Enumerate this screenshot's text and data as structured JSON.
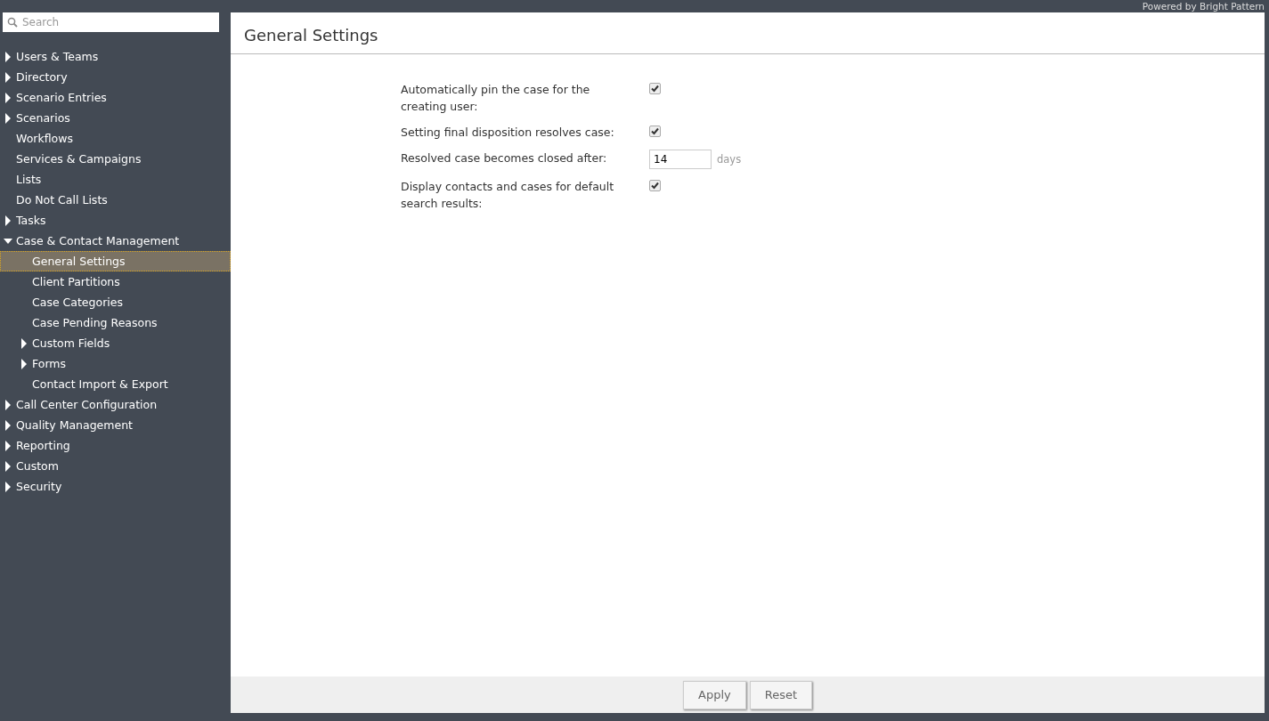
{
  "brand": "Powered by Bright Pattern",
  "search": {
    "placeholder": "Search"
  },
  "sidebar": {
    "items": [
      {
        "label": "Users & Teams",
        "expanded": false,
        "selected": false
      },
      {
        "label": "Directory",
        "expanded": false,
        "selected": false
      },
      {
        "label": "Scenario Entries",
        "expanded": false,
        "selected": false
      },
      {
        "label": "Scenarios",
        "expanded": false,
        "selected": false
      },
      {
        "label": "Workflows",
        "selected": false
      },
      {
        "label": "Services & Campaigns",
        "selected": false
      },
      {
        "label": "Lists",
        "selected": false
      },
      {
        "label": "Do Not Call Lists",
        "selected": false
      },
      {
        "label": "Tasks",
        "expanded": false,
        "selected": false
      },
      {
        "label": "Case & Contact Management",
        "expanded": true,
        "selected": false,
        "children": [
          {
            "label": "General Settings",
            "selected": true
          },
          {
            "label": "Client Partitions",
            "selected": false
          },
          {
            "label": "Case Categories",
            "selected": false
          },
          {
            "label": "Case Pending Reasons",
            "selected": false
          },
          {
            "label": "Custom Fields",
            "expanded": false,
            "selected": false
          },
          {
            "label": "Forms",
            "expanded": false,
            "selected": false
          },
          {
            "label": "Contact Import & Export",
            "selected": false
          }
        ]
      },
      {
        "label": "Call Center Configuration",
        "expanded": false,
        "selected": false
      },
      {
        "label": "Quality Management",
        "expanded": false,
        "selected": false
      },
      {
        "label": "Reporting",
        "expanded": false,
        "selected": false
      },
      {
        "label": "Custom",
        "expanded": false,
        "selected": false
      },
      {
        "label": "Security",
        "expanded": false,
        "selected": false
      }
    ]
  },
  "page": {
    "title": "General Settings"
  },
  "settings": [
    {
      "kind": "checkbox",
      "label": "Automatically pin the case for the creating user:",
      "checked": true
    },
    {
      "kind": "checkbox",
      "label": "Setting final disposition resolves case:",
      "checked": true
    },
    {
      "kind": "number",
      "label": "Resolved case becomes closed after:",
      "value": "14",
      "unit": "days"
    },
    {
      "kind": "checkbox",
      "label": "Display contacts and cases for default search results:",
      "checked": true
    }
  ],
  "buttons": [
    "Apply",
    "Reset"
  ]
}
